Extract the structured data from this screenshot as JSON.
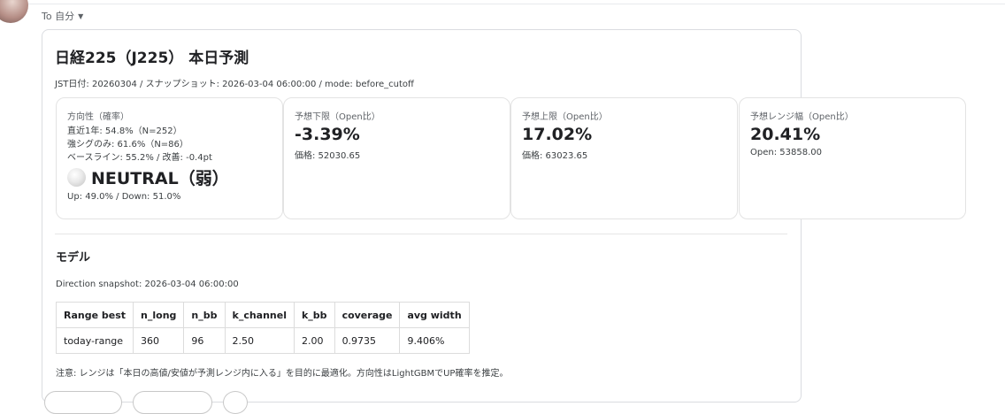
{
  "header": {
    "to_label": "To 自分"
  },
  "report": {
    "title": "日経225（J225） 本日予測",
    "meta": "JST日付: 20260304 / スナップショット: 2026-03-04 06:00:00 / mode: before_cutoff"
  },
  "direction": {
    "label": "方向性（確率）",
    "line1": "直近1年: 54.8%（N=252）",
    "line2": "強シグのみ: 61.6%（N=86）",
    "line3": "ベースライン: 55.2% / 改善: -0.4pt",
    "signal": "NEUTRAL（弱）",
    "updown": "Up: 49.0% / Down: 51.0%"
  },
  "lower": {
    "label": "予想下限（Open比）",
    "value": "-3.39%",
    "sub": "価格: 52030.65"
  },
  "upper": {
    "label": "予想上限（Open比）",
    "value": "17.02%",
    "sub": "価格: 63023.65"
  },
  "range": {
    "label": "予想レンジ幅（Open比）",
    "value": "20.41%",
    "sub": "Open: 53858.00"
  },
  "model": {
    "title": "モデル",
    "snapshot": "Direction snapshot: 2026-03-04 06:00:00",
    "headers": [
      "Range best",
      "n_long",
      "n_bb",
      "k_channel",
      "k_bb",
      "coverage",
      "avg width"
    ],
    "row": [
      "today-range",
      "360",
      "96",
      "2.50",
      "2.00",
      "0.9735",
      "9.406%"
    ],
    "note": "注意: レンジは「本日の高値/安値が予測レンジ内に入る」を目的に最適化。方向性はLightGBMでUP確率を推定。"
  },
  "icons": {
    "caret": "caret-down-icon",
    "signal": "neutral-circle-icon",
    "avatar": "user-avatar"
  },
  "colors": {
    "border": "#dadce0",
    "text": "#202124",
    "muted": "#5f6368"
  }
}
